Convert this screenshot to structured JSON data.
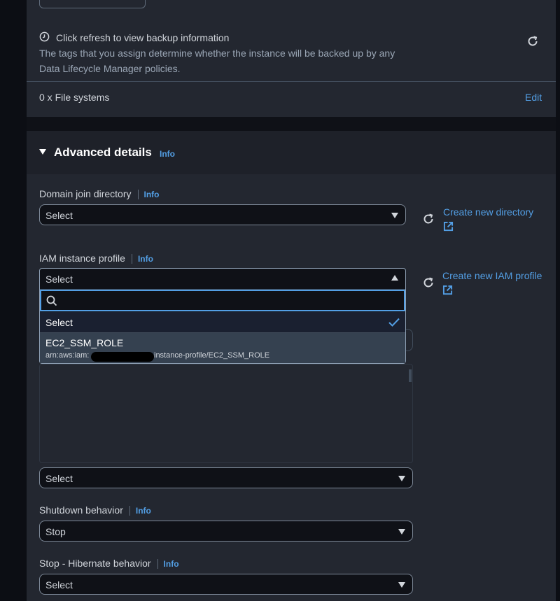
{
  "backup": {
    "title": "Click refresh to view backup information",
    "description_line1": "The tags that you assign determine whether the instance will be backed up by any",
    "description_line2": "Data Lifecycle Manager policies."
  },
  "file_systems": {
    "label": "0 x File systems",
    "edit_label": "Edit"
  },
  "advanced": {
    "title": "Advanced details",
    "info_label": "Info"
  },
  "domain_join": {
    "label": "Domain join directory",
    "info_label": "Info",
    "value": "Select",
    "create_link": "Create new directory"
  },
  "iam_profile": {
    "label": "IAM instance profile",
    "info_label": "Info",
    "value": "Select",
    "create_link": "Create new IAM profile",
    "options": [
      {
        "label": "Select",
        "selected": true
      },
      {
        "label": "EC2_SSM_ROLE",
        "arn_prefix": "arn:aws:iam:",
        "arn_suffix": "instance-profile/EC2_SSM_ROLE"
      }
    ]
  },
  "hidden_select": {
    "value": "Select"
  },
  "shutdown": {
    "label": "Shutdown behavior",
    "info_label": "Info",
    "value": "Stop"
  },
  "hibernate": {
    "label": "Stop - Hibernate behavior",
    "info_label": "Info",
    "value": "Select"
  },
  "colors": {
    "background": "#0f1117",
    "panel": "#232730",
    "link": "#539fe5",
    "text": "#d1d5db"
  }
}
